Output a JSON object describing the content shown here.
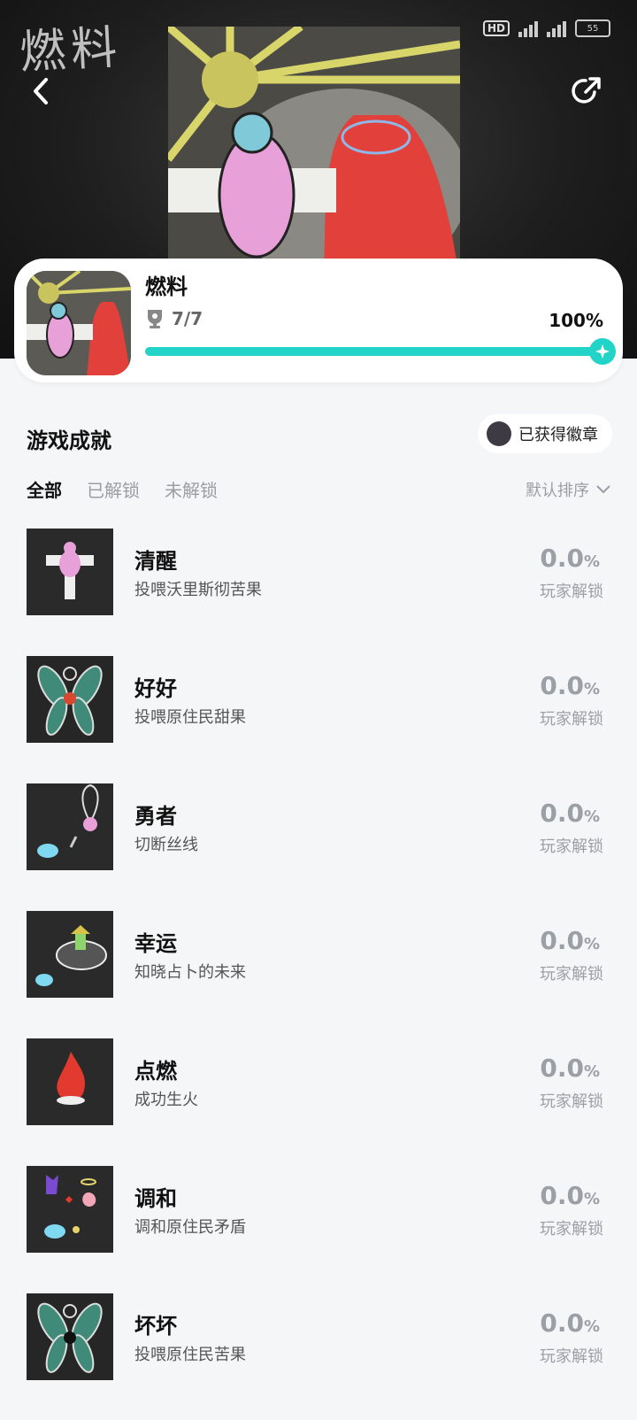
{
  "hero": {
    "watermark_title": "燃料"
  },
  "status_bar": {
    "hd_label": "HD",
    "battery": "55"
  },
  "game": {
    "name": "燃料",
    "trophy_count": "7/7",
    "completion_text": "100%",
    "completion": 1.0
  },
  "section": {
    "title": "游戏成就",
    "badge_button": "已获得徽章"
  },
  "tabs": [
    {
      "label": "全部",
      "active": true
    },
    {
      "label": "已解锁",
      "active": false
    },
    {
      "label": "未解锁",
      "active": false
    }
  ],
  "sort": {
    "label": "默认排序"
  },
  "achievements": [
    {
      "name": "清醒",
      "desc": "投喂沃里斯彻苦果",
      "rate": "0.0",
      "unit": "%",
      "rate_label": "玩家解锁",
      "icon": "rabbit-cross-icon"
    },
    {
      "name": "好好",
      "desc": "投喂原住民甜果",
      "rate": "0.0",
      "unit": "%",
      "rate_label": "玩家解锁",
      "icon": "winged-cat-icon"
    },
    {
      "name": "勇者",
      "desc": "切断丝线",
      "rate": "0.0",
      "unit": "%",
      "rate_label": "玩家解锁",
      "icon": "cut-thread-icon"
    },
    {
      "name": "幸运",
      "desc": "知晓占卜的未来",
      "rate": "0.0",
      "unit": "%",
      "rate_label": "玩家解锁",
      "icon": "fortune-cloud-icon"
    },
    {
      "name": "点燃",
      "desc": "成功生火",
      "rate": "0.0",
      "unit": "%",
      "rate_label": "玩家解锁",
      "icon": "fire-icon"
    },
    {
      "name": "调和",
      "desc": "调和原住民矛盾",
      "rate": "0.0",
      "unit": "%",
      "rate_label": "玩家解锁",
      "icon": "reconcile-icon"
    },
    {
      "name": "坏坏",
      "desc": "投喂原住民苦果",
      "rate": "0.0",
      "unit": "%",
      "rate_label": "玩家解锁",
      "icon": "winged-cat-dark-icon"
    }
  ]
}
